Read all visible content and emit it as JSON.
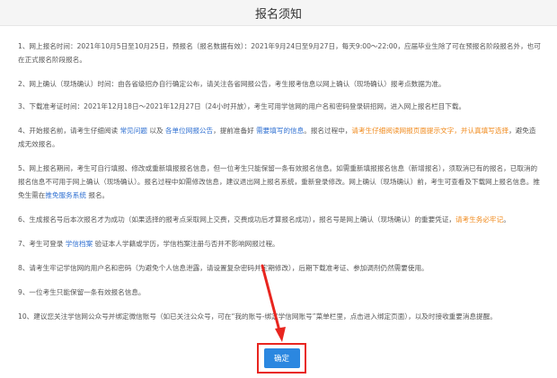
{
  "header": {
    "title": "报名须知"
  },
  "items": {
    "i1": "1、网上报名时间：2021年10月5日至10月25日，预报名（报名数据有效）：2021年9月24日至9月27日，每天9:00～22:00，应届毕业生除了可在预报名阶段报名外，也可在正式报名阶段报名。",
    "i2": "2、网上确认（现场确认）时间：由各省级招办自行确定公布，请关注各省网报公告，考生报考信息以网上确认（现场确认）报考点数据为准。",
    "i3": "3、下载准考证时间：2021年12月18日～2021年12月27日（24小时开放），考生可用学信网的用户名和密码登录研招网，进入网上报名栏目下载。",
    "i4": {
      "a": "4、开始报名前，请考生仔细阅读 ",
      "link1": "常见问题",
      "b": " 以及 ",
      "link2": "各单位网报公告",
      "c": "，提前准备好 ",
      "link3": "需要填写的信息",
      "d": "。报名过程中，",
      "highlight": "请考生仔细阅读网报页面提示文字，并认真填写选择",
      "e": "，避免造成无效报名。"
    },
    "i5": {
      "a": "5、网上报名期间，考生可自行填报、修改或重新填报报名信息，但一位考生只能保留一条有效报名信息。如需重新填报报名信息（新增报名），须取消已有的报名，已取消的报名信息不可用于网上确认（现场确认）。报名过程中如需修改信息，建议退出网上报名系统，重新登录修改。网上确认（现场确认）前，考生可查看及下载网上报名信息。推免生需在",
      "link": "推免服务系统",
      "b": " 报名。"
    },
    "i6": {
      "a": "6、生成报名号后本次报名才为成功（如果选择的报考点采取网上交费，交费成功后才算报名成功），报名号是网上确认（现场确认）的重要凭证，",
      "highlight": "请考生务必牢记",
      "b": "。"
    },
    "i7": {
      "a": "7、考生可登录 ",
      "link": "学信档案",
      "b": " 验证本人学籍或学历，学信档案注册与否并不影响网报过程。"
    },
    "i8": "8、请考生牢记学信网的用户名和密码（为避免个人信息泄露，请设置复杂密码并定期修改），后期下载准考证、参加调剂仍然需要使用。",
    "i9": "9、一位考生只能保留一条有效报名信息。",
    "i10": "10、建议您关注学信网公众号并绑定微信账号（如已关注公众号，可在“我的账号-绑定学信网账号”菜单栏里，点击进入绑定页面），以及时接收重要消息提醒。"
  },
  "confirm_button": {
    "label": "确定"
  },
  "colors": {
    "link": "#2e6fd1",
    "highlight": "#f08a1c",
    "button": "#2b87e0",
    "annotation": "#e8251f"
  }
}
